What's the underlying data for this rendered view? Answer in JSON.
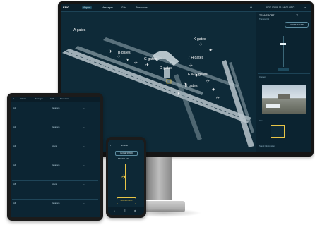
{
  "monitor": {
    "topbar": {
      "logo": "ENG",
      "tabs": [
        "Airport",
        "Messages",
        "Grid",
        "Resources"
      ],
      "datetime": "2023-03-08 11:24:00 UTC"
    },
    "map": {
      "gate_labels": [
        "A gates",
        "K gates",
        "B gates",
        "C gates",
        "7 H gates",
        "D gates",
        "F & G gates",
        "E gates"
      ]
    },
    "right_panel": {
      "title": "TRANSPORT",
      "subtitle": "Transport 1",
      "button": "CLOSE STAND",
      "section_camera": "Camera",
      "section_info": "Info",
      "section_bottom": "Stand Information"
    },
    "colors": {
      "screen_bg": "#0e2a38",
      "runway": "#b9c6cc",
      "accent": "#e8c547",
      "plane": "#ffffff"
    }
  },
  "tablet": {
    "topbar": [
      "Airport",
      "Messages",
      "Grid",
      "Resources"
    ],
    "rows": [
      {
        "a": "A1",
        "b": "Departure",
        "c": "—"
      },
      {
        "a": "A2",
        "b": "Departure",
        "c": "—"
      },
      {
        "a": "A3",
        "b": "Arrival",
        "c": "—"
      },
      {
        "a": "A4",
        "b": "Departure",
        "c": "—"
      },
      {
        "a": "A5",
        "b": "Arrival",
        "c": "—"
      },
      {
        "a": "A6",
        "b": "Departure",
        "c": "—"
      }
    ]
  },
  "phone": {
    "title": "STAND",
    "button_top": "CLOSE STAND",
    "stand_id": "STAND 101",
    "button_bottom": "OPEN STAND",
    "footer_icons": [
      "home-icon",
      "list-icon",
      "gear-icon"
    ]
  }
}
